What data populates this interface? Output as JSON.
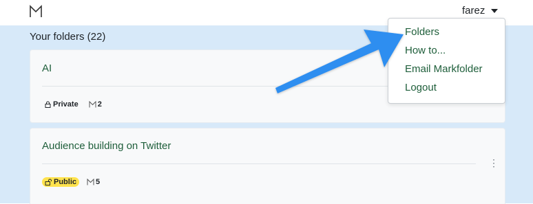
{
  "header": {
    "logo_icon": "markfolder-logo-icon",
    "user_name": "farez"
  },
  "main": {
    "heading": "Your folders (22)"
  },
  "folders": [
    {
      "title": "AI",
      "visibility": "Private",
      "visibility_icon": "lock-icon",
      "bookmark_count": "2"
    },
    {
      "title": "Audience building on Twitter",
      "visibility": "Public",
      "visibility_icon": "unlock-icon",
      "bookmark_count": "5",
      "badge_color": "#ffe34d"
    }
  ],
  "user_menu": {
    "items": [
      "Folders",
      "How to...",
      "Email Markfolder",
      "Logout"
    ]
  },
  "annotation": {
    "arrow_color": "#2d8ef0"
  }
}
